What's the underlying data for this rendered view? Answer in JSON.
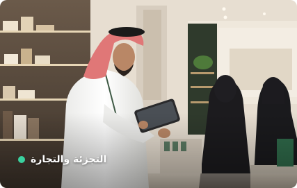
{
  "caption": {
    "text": "التجزئة والتجارة",
    "dot_color": "#3ad29f"
  },
  "image": {
    "subject": "photo-retail-store"
  }
}
